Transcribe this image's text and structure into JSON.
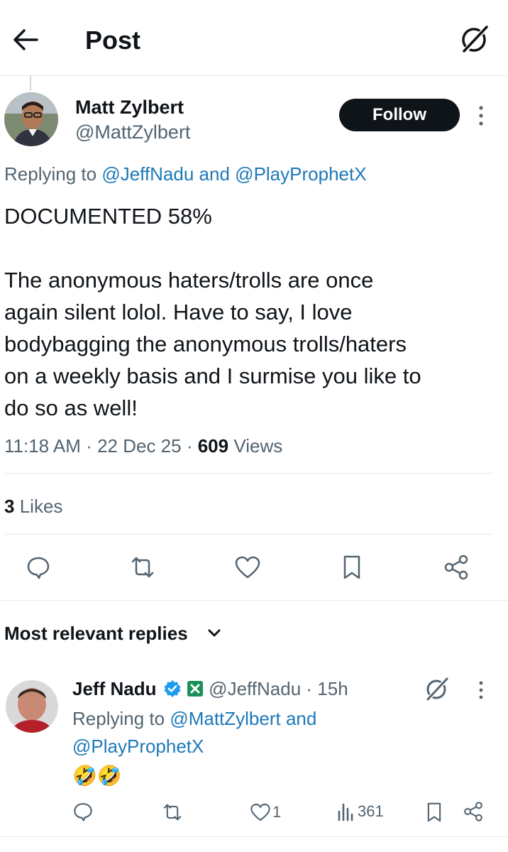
{
  "header": {
    "title": "Post"
  },
  "tweet": {
    "author_name": "Matt Zylbert",
    "author_handle": "@MattZylbert",
    "follow_label": "Follow",
    "replying_prefix": "Replying to",
    "reply_to_1": "@JeffNadu",
    "reply_and": "and",
    "reply_to_2": "@PlayProphetX",
    "body_line1": "DOCUMENTED 58%",
    "body_p2_l1": "The anonymous haters/trolls are once",
    "body_p2_l2": "again silent lolol. Have to say, I love",
    "body_p2_l3": "bodybagging the anonymous trolls/haters",
    "body_p2_l4": "on a weekly basis and I surmise you like to",
    "body_p2_l5": "do so as well!",
    "time": "11:18 AM",
    "date": "22 Dec 25",
    "views_count": "609",
    "views_label": "Views",
    "likes_count": "3",
    "likes_label": "Likes"
  },
  "replies_section": {
    "label": "Most relevant replies"
  },
  "reply": {
    "author_name": "Jeff Nadu",
    "author_handle": "@JeffNadu",
    "time_ago": "15h",
    "replying_prefix": "Replying to",
    "reply_to_1": "@MattZylbert",
    "reply_and": "and",
    "reply_to_2": "@PlayProphetX",
    "emoji_text": "🤣🤣",
    "like_count": "1",
    "views_count": "361"
  },
  "colors": {
    "link": "#1d79b8",
    "muted": "#536471",
    "text": "#0f1419",
    "verified": "#1d9bf0",
    "follow_bg": "#0f1419"
  },
  "icons": {
    "back": "arrow-left-icon",
    "grok_header": "grok-icon",
    "more": "more-vertical-icon",
    "reply": "comment-icon",
    "retweet": "retweet-icon",
    "like": "heart-icon",
    "bookmark": "bookmark-icon",
    "share": "share-icon",
    "views": "views-bar-icon",
    "verified": "verified-badge-icon",
    "affiliate": "affiliate-badge-icon"
  }
}
